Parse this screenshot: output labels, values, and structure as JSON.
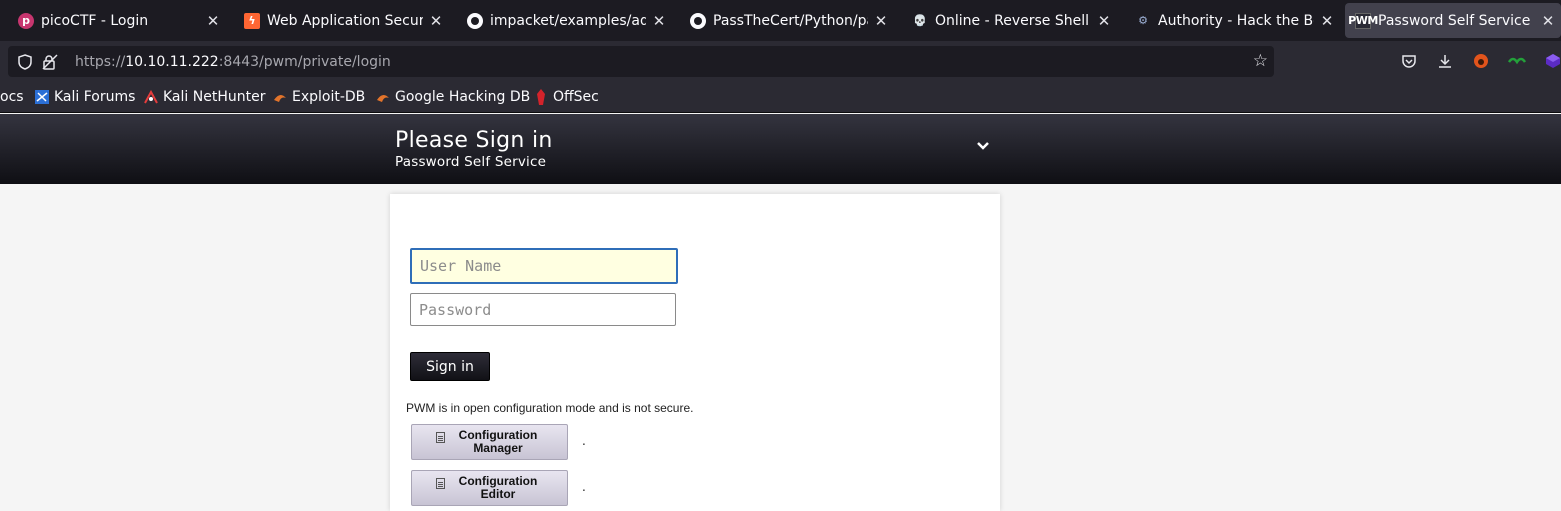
{
  "browser": {
    "tabs": [
      {
        "title": "picoCTF - Login",
        "icon": "picoctf-icon"
      },
      {
        "title": "Web Application Security",
        "icon": "was-icon"
      },
      {
        "title": "impacket/examples/addc",
        "icon": "github-icon"
      },
      {
        "title": "PassTheCert/Python/pas",
        "icon": "github-icon"
      },
      {
        "title": "Online - Reverse Shell Ge",
        "icon": "skull-icon"
      },
      {
        "title": "Authority - Hack the Box |",
        "icon": "htb-icon"
      },
      {
        "title": "Password Self Service",
        "icon": "pwm-icon",
        "active": true
      }
    ],
    "url": {
      "scheme": "https://",
      "host": "10.10.11.222",
      "rest": ":8443/pwm/private/login"
    },
    "bookmarks": [
      {
        "label": "ocs"
      },
      {
        "label": "Kali Forums",
        "icon": "kali-icon"
      },
      {
        "label": "Kali NetHunter",
        "icon": "nethunter-icon"
      },
      {
        "label": "Exploit-DB",
        "icon": "exploitdb-icon"
      },
      {
        "label": "Google Hacking DB",
        "icon": "ghdb-icon"
      },
      {
        "label": "OffSec",
        "icon": "offsec-icon"
      }
    ],
    "accent": "#1c1b22"
  },
  "header": {
    "title": "Please Sign in",
    "subtitle": "Password Self Service"
  },
  "login": {
    "username_placeholder": "User Name",
    "password_placeholder": "Password",
    "signin_label": "Sign in",
    "notice": "PWM is in open configuration mode and is not secure.",
    "config_manager_label": "Configuration Manager",
    "config_editor_label": "Configuration Editor",
    "dot": "."
  }
}
